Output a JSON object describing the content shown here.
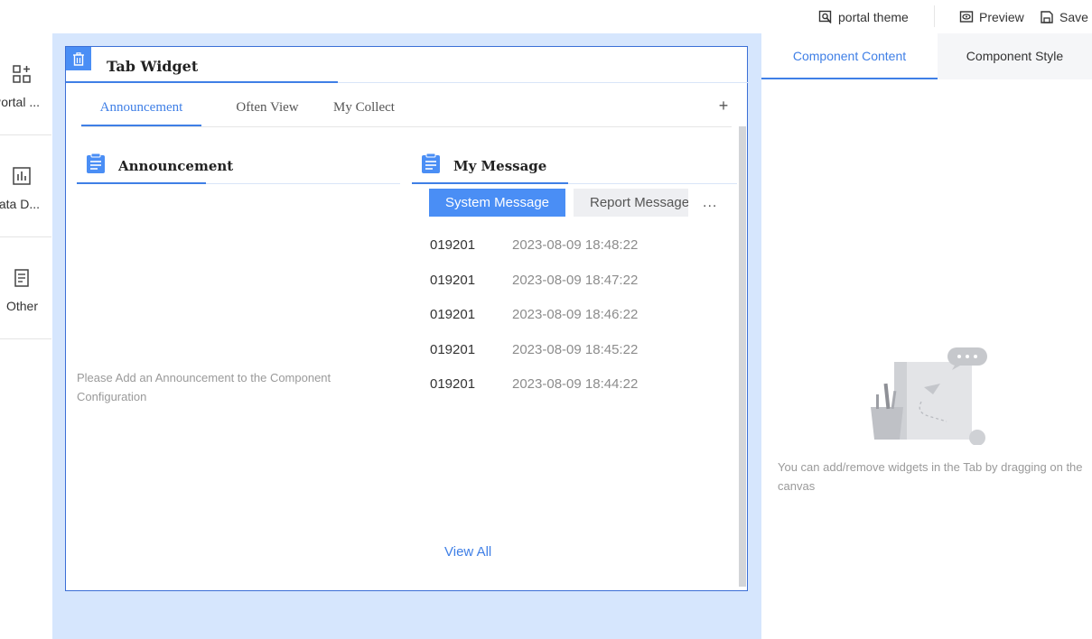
{
  "toolbar": {
    "portal_theme": "portal theme",
    "preview": "Preview",
    "save": "Save"
  },
  "sidebar": {
    "items": [
      {
        "label": "Portal ...",
        "icon": "grid-plus-icon"
      },
      {
        "label": "Data D...",
        "icon": "bar-chart-icon"
      },
      {
        "label": "Other",
        "icon": "document-icon"
      }
    ]
  },
  "widget": {
    "title": "Tab Widget",
    "tabs": [
      "Announcement",
      "Often View",
      "My Collect"
    ],
    "add_tab_label": "+",
    "announcement": {
      "title": "Announcement",
      "empty_text": "Please Add an Announcement to the Component Configuration"
    },
    "message": {
      "title": "My Message",
      "tabs": [
        "System Message",
        "Report Message"
      ],
      "more_label": "...",
      "rows": [
        {
          "id": "019201",
          "time": "2023-08-09 18:48:22"
        },
        {
          "id": "019201",
          "time": "2023-08-09 18:47:22"
        },
        {
          "id": "019201",
          "time": "2023-08-09 18:46:22"
        },
        {
          "id": "019201",
          "time": "2023-08-09 18:45:22"
        },
        {
          "id": "019201",
          "time": "2023-08-09 18:44:22"
        }
      ],
      "view_all": "View All"
    }
  },
  "right_panel": {
    "tabs": [
      "Component Content",
      "Component Style"
    ],
    "active_tab": "Component Content",
    "hint": "You can add/remove widgets in the Tab by dragging on the canvas"
  },
  "colors": {
    "accent": "#3f7fe6",
    "canvas_bg": "#d6e6fd",
    "button_blue": "#4a8ef5"
  }
}
